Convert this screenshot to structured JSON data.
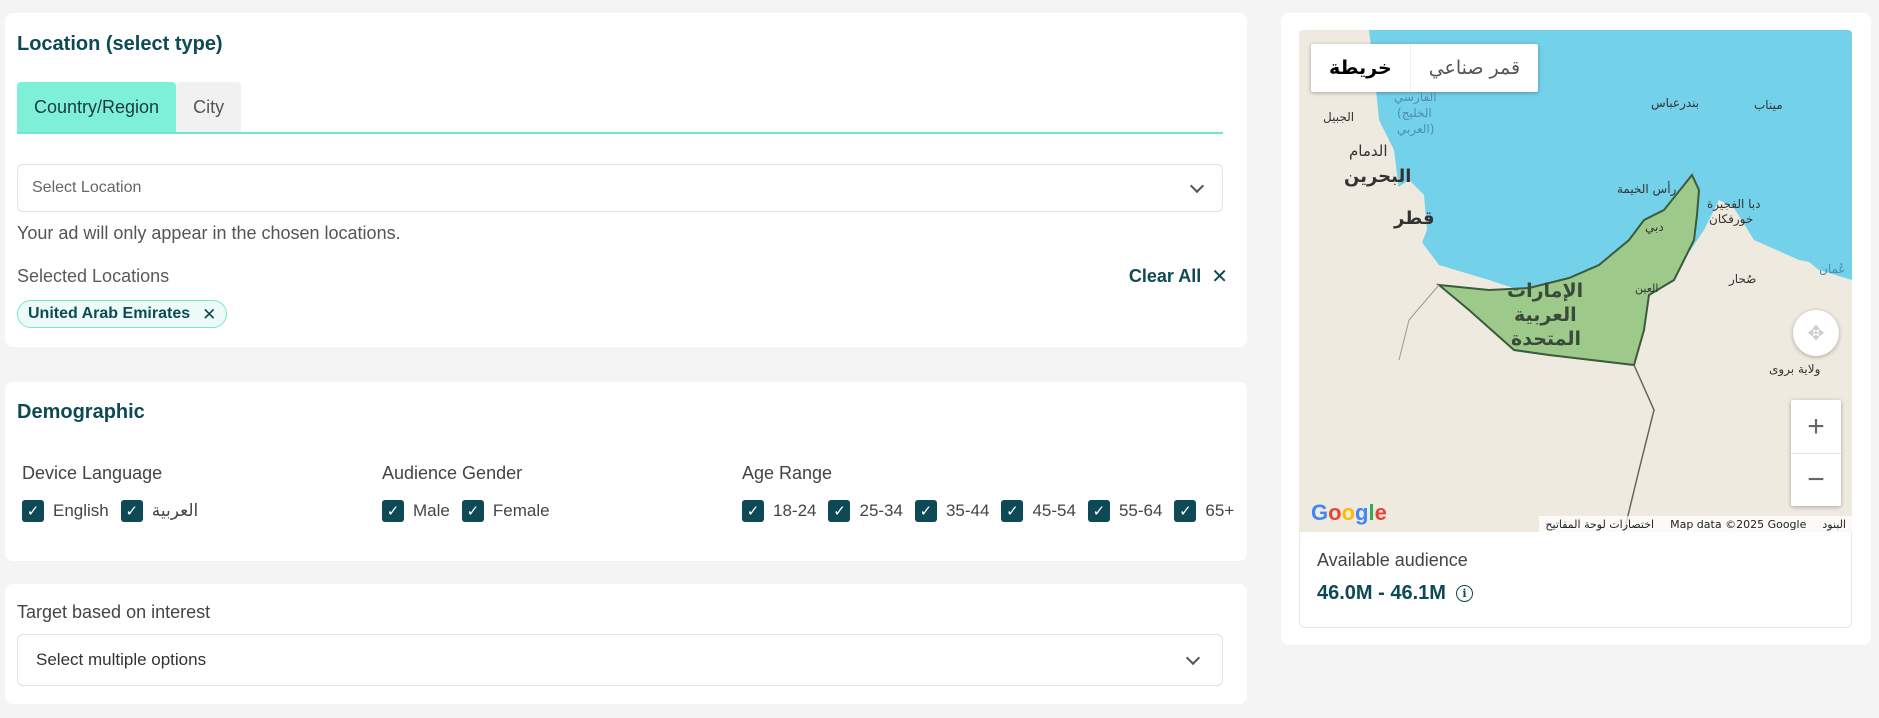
{
  "location": {
    "title": "Location (select type)",
    "tabs": [
      {
        "label": "Country/Region",
        "active": true
      },
      {
        "label": "City",
        "active": false
      }
    ],
    "select_placeholder": "Select Location",
    "help_text": "Your ad will only appear in the chosen locations.",
    "selected_label": "Selected Locations",
    "clear_all_label": "Clear All",
    "selected_items": [
      "United Arab Emirates"
    ]
  },
  "demographic": {
    "title": "Demographic",
    "device_language": {
      "label": "Device Language",
      "options": [
        {
          "label": "English",
          "checked": true
        },
        {
          "label": "العربية",
          "checked": true
        }
      ]
    },
    "audience_gender": {
      "label": "Audience Gender",
      "options": [
        {
          "label": "Male",
          "checked": true
        },
        {
          "label": "Female",
          "checked": true
        }
      ]
    },
    "age_range": {
      "label": "Age Range",
      "options": [
        {
          "label": "18-24",
          "checked": true
        },
        {
          "label": "25-34",
          "checked": true
        },
        {
          "label": "35-44",
          "checked": true
        },
        {
          "label": "45-54",
          "checked": true
        },
        {
          "label": "55-64",
          "checked": true
        },
        {
          "label": "65+",
          "checked": true
        }
      ]
    }
  },
  "interest": {
    "label": "Target based on interest",
    "placeholder": "Select multiple options"
  },
  "map": {
    "toggle_map": "خريطة",
    "toggle_satellite": "قمر صناعي",
    "labels": {
      "uae": [
        "الإمارات",
        "العربية",
        "المتحدة"
      ],
      "bahrain": "البحرين",
      "qatar": "قطر",
      "dammam": "الدمام",
      "jubail": "الجبيل",
      "gulf": [
        "الفارسي",
        "(الخليج",
        "العربي)"
      ],
      "dubai": "دبي",
      "ras_al_khaimah": "رأس الخيمة",
      "fujairah": "دبا الفجيرة",
      "khorfakkan": "خورفكان",
      "sohar": "صُحار",
      "bandar_abbas": "بندرعباس",
      "minab": "ميناب",
      "oman": "عُمان",
      "ibri": "ولاية بروى",
      "al_ain": "العين"
    },
    "google": "Google",
    "footer": {
      "shortcuts": "اختصارات لوحة المفاتيح",
      "data": "Map data ©2025 Google",
      "terms": "البنود"
    },
    "colors": {
      "water": "#74d1ea",
      "land": "#efeae0",
      "highlight": "#9dc98a"
    }
  },
  "audience": {
    "label": "Available audience",
    "value": "46.0M - 46.1M"
  }
}
